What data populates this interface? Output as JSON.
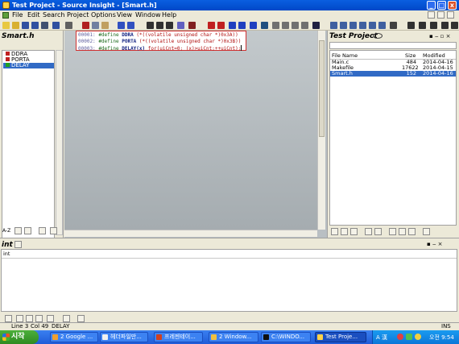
{
  "window": {
    "title": "Test Project - Source Insight - [Smart.h]",
    "buttons": {
      "minimize": "_",
      "maximize": "□",
      "close": "x"
    }
  },
  "menu": [
    "File",
    "Edit",
    "Search",
    "Project",
    "Options",
    "View",
    "Window",
    "Help"
  ],
  "symbol_panel": {
    "title": "Smart.h",
    "items": [
      {
        "label": "DDRA",
        "color": "#c02020"
      },
      {
        "label": "PORTA",
        "color": "#c02020"
      },
      {
        "label": "DELAY",
        "color": "#20a020"
      }
    ],
    "sort_label": "A-Z"
  },
  "code": {
    "lines": [
      {
        "num": "00001:",
        "kw": "#define",
        "name": "DDRA",
        "value": "(*((volatile unsigned char *)0x3A))"
      },
      {
        "num": "00002:",
        "kw": "#define",
        "name": "PORTA",
        "value": "(*((volatile unsigned char *)0x3B))"
      },
      {
        "num": "00003:",
        "kw": "#define",
        "name": "DELAY(x)",
        "value": "for(uiCnt=0; (x)>uiCnt;++uiCnt);"
      }
    ]
  },
  "project_panel": {
    "title": "Test Project",
    "columns": [
      "File Name",
      "Size",
      "Modified"
    ],
    "files": [
      {
        "name": "Main.c",
        "size": "484",
        "modified": "2014-04-16"
      },
      {
        "name": "Makefile",
        "size": "17622",
        "modified": "2014-04-15"
      },
      {
        "name": "Smart.h",
        "size": "152",
        "modified": "2014-04-16"
      }
    ]
  },
  "context_panel": {
    "title": "int",
    "content": "int"
  },
  "status": {
    "line": "Line 3",
    "col": "Col 49",
    "symbol": "DELAY",
    "mode": "INS"
  },
  "taskbar": {
    "start": "시작",
    "tasks": [
      "2 Google ...",
      "헤더파일만...",
      "프레젠테이...",
      "2 Window...",
      "C:\\WINDO...",
      "Test Proje..."
    ],
    "tray_lang": "A 漢",
    "clock": "오전 9:54"
  }
}
